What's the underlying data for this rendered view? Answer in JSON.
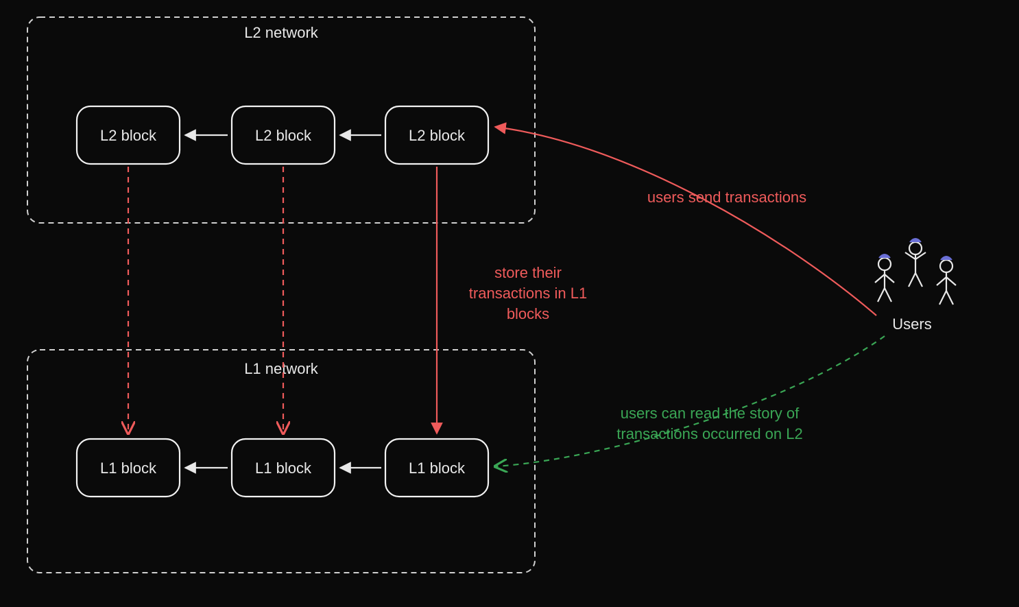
{
  "colors": {
    "background": "#0a0a0a",
    "stroke_white": "#e8e8e8",
    "stroke_red": "#ef5b5b",
    "stroke_green": "#3aa655",
    "cap_blue": "#6a6fd6"
  },
  "networks": {
    "l2": {
      "title": "L2 network",
      "blocks": [
        "L2 block",
        "L2 block",
        "L2 block"
      ]
    },
    "l1": {
      "title": "L1 network",
      "blocks": [
        "L1 block",
        "L1 block",
        "L1 block"
      ]
    }
  },
  "actors": {
    "users_label": "Users"
  },
  "annotations": {
    "users_send": "users send transactions",
    "store_l1_line1": "store their",
    "store_l1_line2": "transactions in L1",
    "store_l1_line3": "blocks",
    "read_story_line1": "users can read the story of",
    "read_story_line2": "transactions occurred on L2"
  }
}
